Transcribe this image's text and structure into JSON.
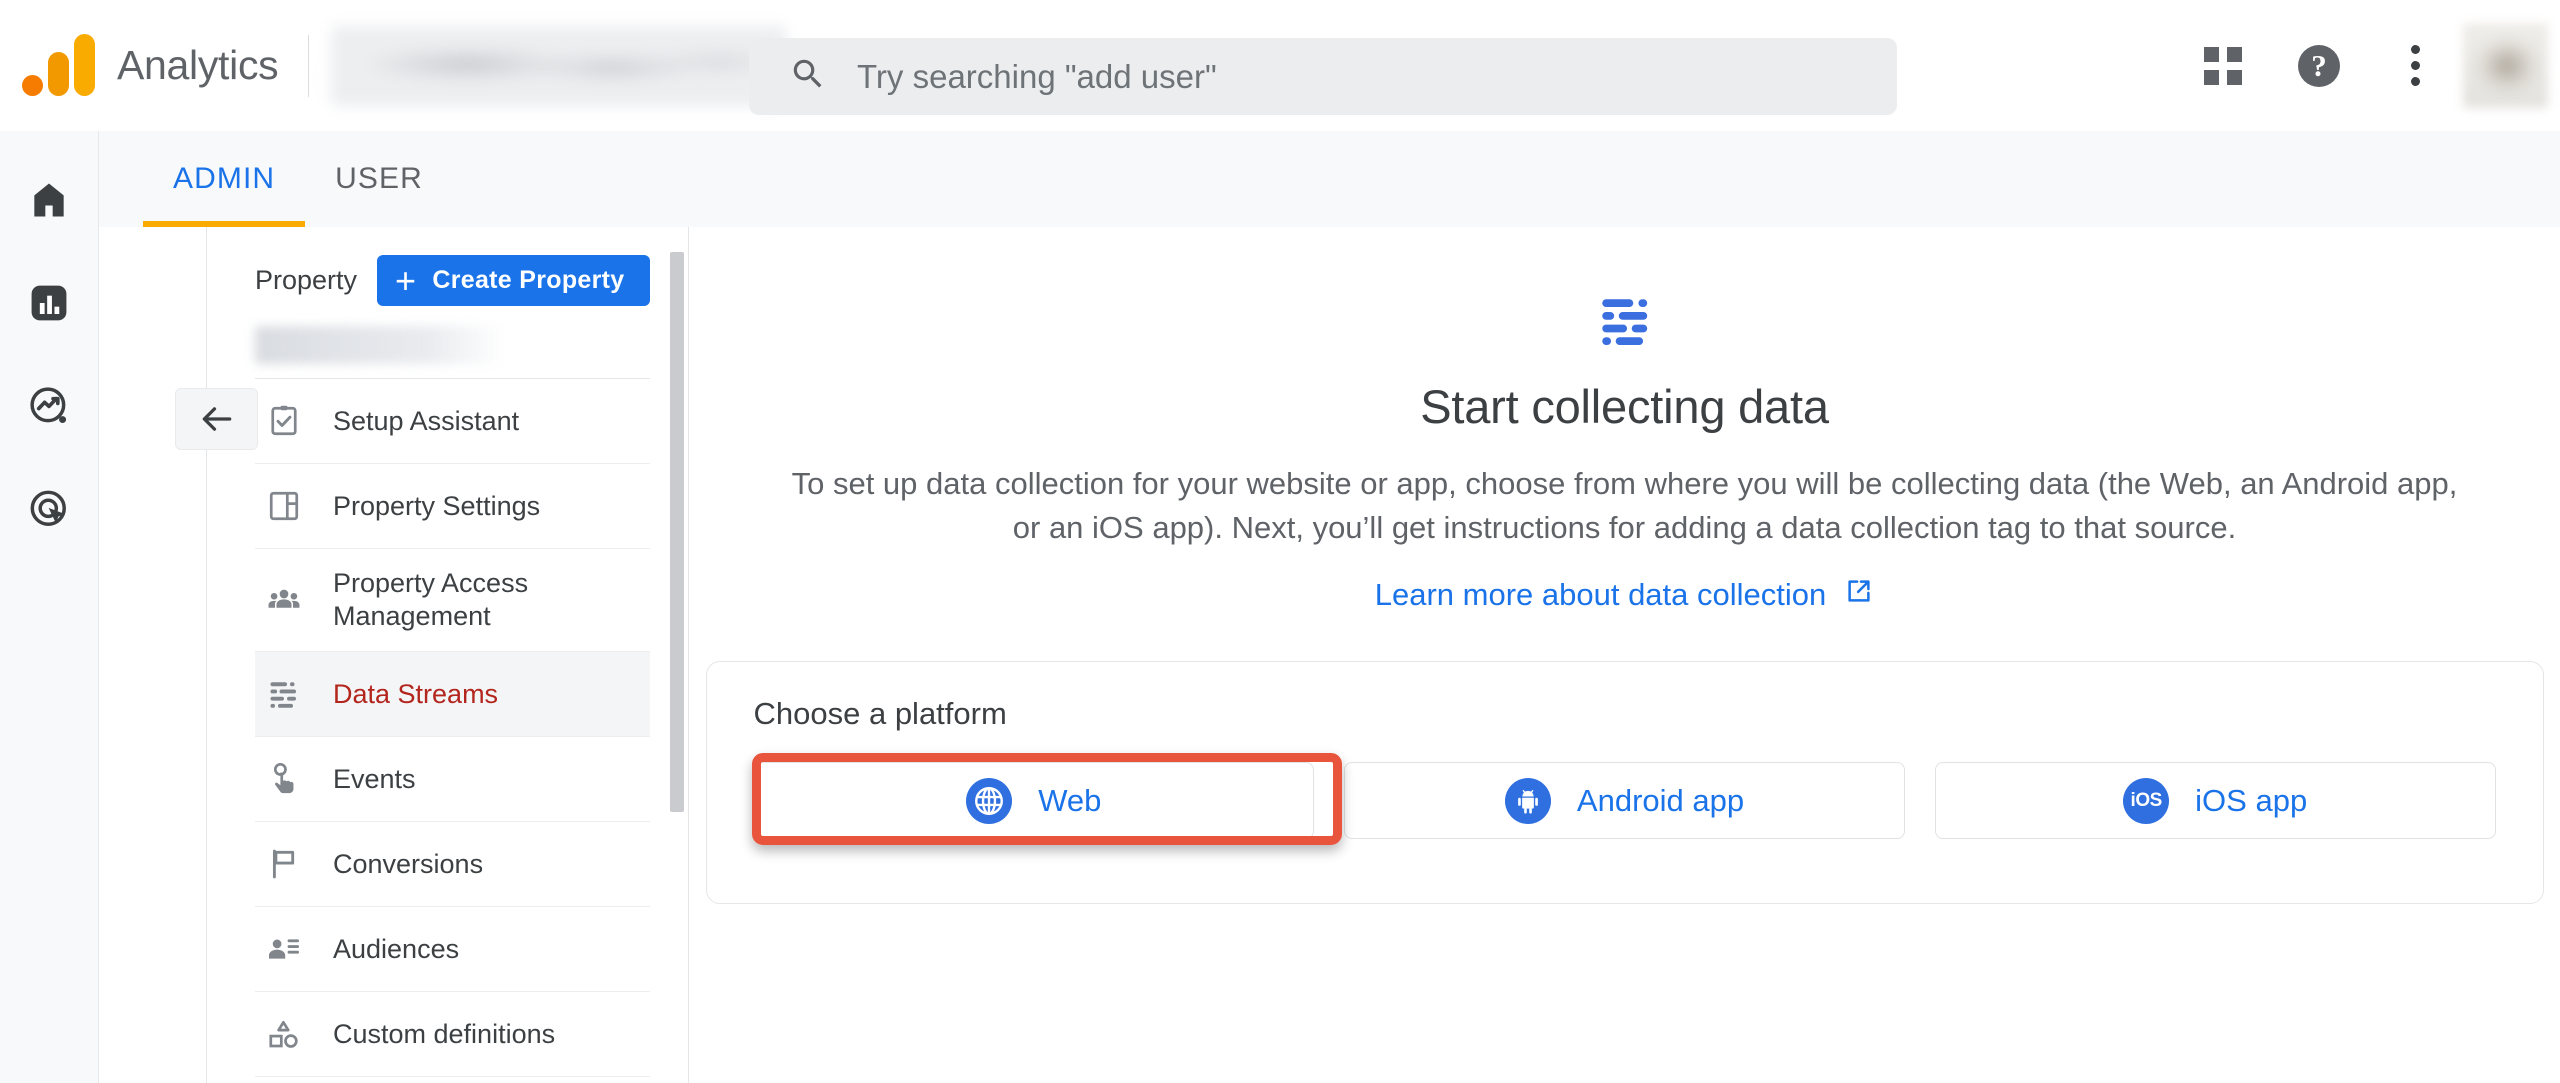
{
  "header": {
    "brand": "Analytics",
    "search_placeholder": "Try searching \"add user\"",
    "apps_label": "Google apps",
    "help_label": "?",
    "menu_label": "More options",
    "avatar_label": "Account"
  },
  "rail": {
    "items": [
      {
        "name": "home",
        "label": "Home"
      },
      {
        "name": "reports",
        "label": "Reports"
      },
      {
        "name": "explore",
        "label": "Explore"
      },
      {
        "name": "advertising",
        "label": "Advertising"
      }
    ]
  },
  "tabs": [
    {
      "label": "ADMIN",
      "active": true
    },
    {
      "label": "USER",
      "active": false
    }
  ],
  "admin": {
    "property_label": "Property",
    "create_button": "Create Property",
    "create_plus": "+",
    "collapse_label": "Collapse",
    "nav": [
      {
        "label": "Setup Assistant",
        "active": false
      },
      {
        "label": "Property Settings",
        "active": false
      },
      {
        "label": "Property Access Management",
        "active": false
      },
      {
        "label": "Data Streams",
        "active": true
      },
      {
        "label": "Events",
        "active": false
      },
      {
        "label": "Conversions",
        "active": false
      },
      {
        "label": "Audiences",
        "active": false
      },
      {
        "label": "Custom definitions",
        "active": false
      }
    ]
  },
  "main": {
    "title": "Start collecting data",
    "description": "To set up data collection for your website or app, choose from where you will be collecting data (the Web, an Android app, or an iOS app). Next, you’ll get instructions for adding a data collection tag to that source.",
    "learn_more": "Learn more about data collection",
    "platform_title": "Choose a platform",
    "platforms": [
      {
        "label": "Web",
        "icon": "globe-icon",
        "highlighted": true
      },
      {
        "label": "Android app",
        "icon": "android-icon",
        "highlighted": false
      },
      {
        "label": "iOS app",
        "icon": "ios-icon",
        "highlighted": false
      }
    ],
    "ios_badge": "iOS"
  },
  "colors": {
    "accent_blue": "#1A73E8",
    "active_red": "#B3261E",
    "tab_underline": "#F9AB00",
    "highlight": "#E8553C",
    "logo_orange": "#F9AB00"
  }
}
